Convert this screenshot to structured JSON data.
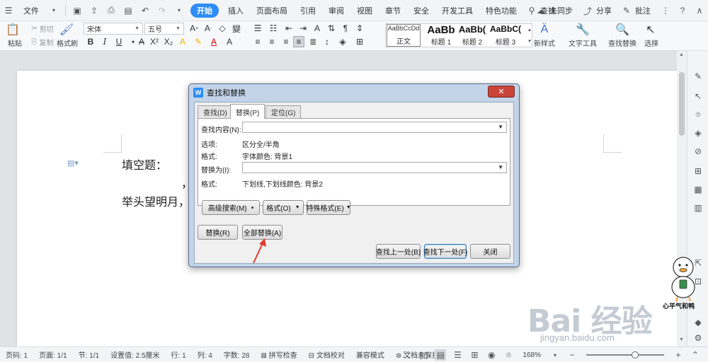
{
  "menubar": {
    "file_label": "文件",
    "tabs": [
      "开始",
      "插入",
      "页面布局",
      "引用",
      "审阅",
      "视图",
      "章节",
      "安全",
      "开发工具",
      "特色功能"
    ],
    "active_tab": "开始",
    "search_label": "查找",
    "sync_label": "未同步",
    "share_label": "分享",
    "comment_label": "批注"
  },
  "ribbon": {
    "paste_label": "粘贴",
    "cut_label": "剪切",
    "copy_label": "复制",
    "format_painter_label": "格式刷",
    "font_name": "宋体",
    "font_size": "五号",
    "styles": [
      {
        "sample": "AaBbCcDd",
        "name": "正文"
      },
      {
        "sample": "AaBb",
        "name": "标题 1"
      },
      {
        "sample": "AaBb(",
        "name": "标题 2"
      },
      {
        "sample": "AaBbC(",
        "name": "标题 3"
      }
    ],
    "new_style_label": "新样式",
    "text_tools_label": "文字工具",
    "find_replace_label": "查找替换",
    "select_label": "选择"
  },
  "document": {
    "line1": "填空题：",
    "line2_mark": "，",
    "line3": "举头望明月，"
  },
  "dialog": {
    "title": "查找和替换",
    "close_symbol": "✕",
    "tabs": [
      "查找(D)",
      "替换(P)",
      "定位(G)"
    ],
    "active_tab": "替换(P)",
    "find_label": "查找内容(N):",
    "find_value": "",
    "options_label": "选项:",
    "options_value": "区分全/半角",
    "find_format_label": "格式:",
    "find_format_value": "字体颜色: 背景1",
    "replace_label": "替换为(I):",
    "replace_value": "",
    "replace_format_label": "格式:",
    "replace_format_value": "下划线,下划线颜色: 背景2",
    "advanced_search": "高级搜索(M)",
    "format_button": "格式(O)",
    "special_format": "特殊格式(E)",
    "replace_button": "替换(R)",
    "replace_all_button": "全部替换(A)",
    "find_prev": "查找上一处(B)",
    "find_next": "查找下一处(F)",
    "close_button": "关闭"
  },
  "statusbar": {
    "page_code": "页码: 1",
    "pages": "页面: 1/1",
    "section": "节: 1/1",
    "setting_value": "设置值: 2.5厘米",
    "row": "行: 1",
    "col": "列: 4",
    "word_count": "字数: 28",
    "spell_check": "拼写检查",
    "doc_proof": "文档校对",
    "compat_mode": "兼容模式",
    "doc_unprotected": "文档未保护",
    "zoom": "168%"
  },
  "watermark": {
    "logo": "Bai  经验",
    "url": "jingyan.baidu.com",
    "mascot_text": "心平气和鸭"
  },
  "colors": {
    "accent": "#2e8df5",
    "dialog_frame": "#c3d4e8",
    "close_red": "#c9453a",
    "annotation_arrow": "#e23a2e"
  }
}
